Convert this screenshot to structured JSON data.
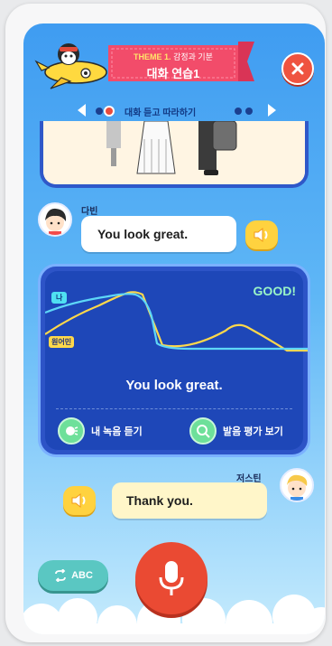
{
  "header": {
    "theme_prefix": "THEME 1.",
    "theme_title": "감정과 기분",
    "lesson_title": "대화 연습1",
    "close_icon": "close-icon"
  },
  "progress": {
    "label": "대화 듣고 따라하기",
    "prev_icon": "chevron-left-icon",
    "next_icon": "chevron-right-icon"
  },
  "dialog": {
    "speaker1": {
      "name": "다빈",
      "line": "You look great."
    },
    "speaker2": {
      "name": "저스틴",
      "line": "Thank you."
    }
  },
  "pronunciation": {
    "rating": "GOOD!",
    "me_tag": "나",
    "native_tag": "원어민",
    "sentence": "You look great.",
    "my_recording_label": "내 녹음 듣기",
    "evaluation_label": "발음 평가 보기",
    "colors": {
      "me": "#5ed7f7",
      "native": "#ffd84a"
    }
  },
  "controls": {
    "abc_label": "ABC",
    "mic_icon": "microphone-icon"
  }
}
